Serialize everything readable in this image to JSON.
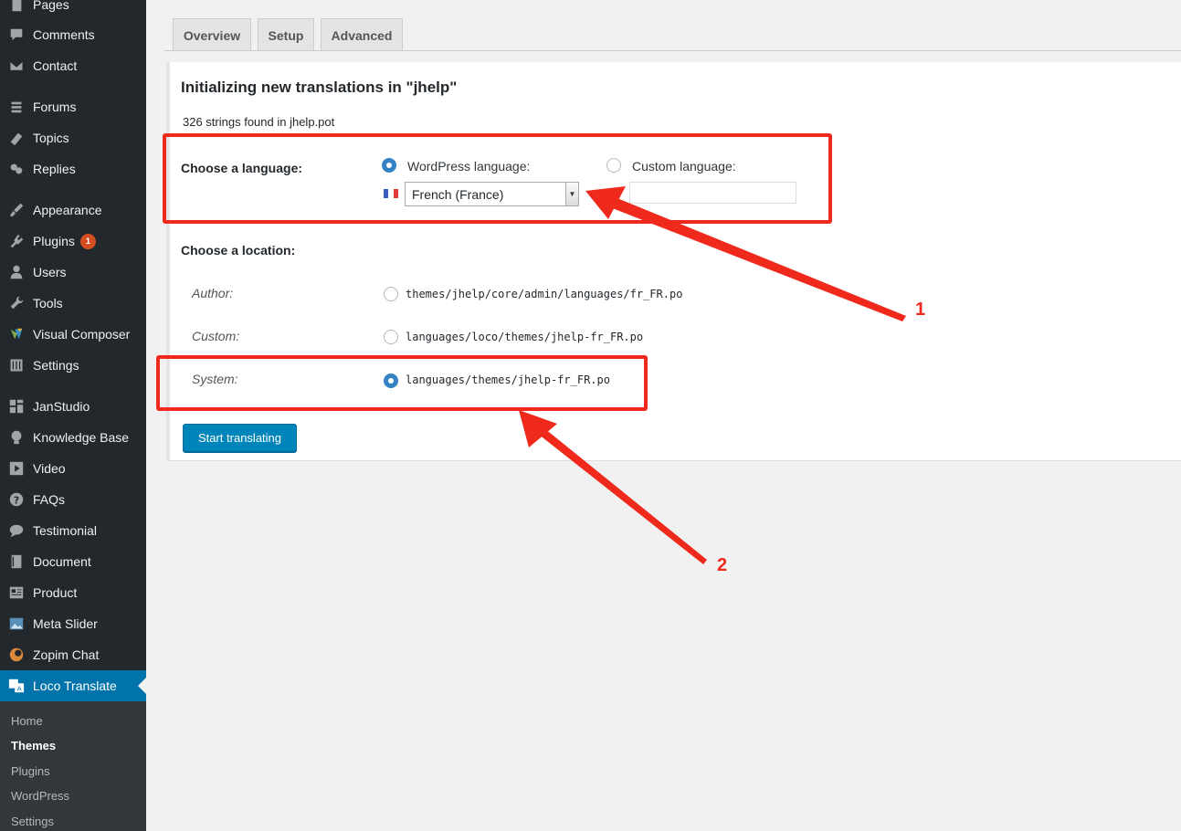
{
  "sidebar": {
    "items": [
      {
        "label": "Pages",
        "icon": "pages-icon"
      },
      {
        "label": "Comments",
        "icon": "comments-icon"
      },
      {
        "label": "Contact",
        "icon": "mail-icon"
      },
      {
        "label": "Forums",
        "icon": "forums-icon"
      },
      {
        "label": "Topics",
        "icon": "topics-icon"
      },
      {
        "label": "Replies",
        "icon": "replies-icon"
      },
      {
        "label": "Appearance",
        "icon": "brush-icon"
      },
      {
        "label": "Plugins",
        "icon": "plugin-icon",
        "badge": "1"
      },
      {
        "label": "Users",
        "icon": "users-icon"
      },
      {
        "label": "Tools",
        "icon": "wrench-icon"
      },
      {
        "label": "Visual Composer",
        "icon": "visual-composer-icon"
      },
      {
        "label": "Settings",
        "icon": "settings-icon"
      },
      {
        "label": "JanStudio",
        "icon": "grid-icon"
      },
      {
        "label": "Knowledge Base",
        "icon": "lightbulb-icon"
      },
      {
        "label": "Video",
        "icon": "video-icon"
      },
      {
        "label": "FAQs",
        "icon": "question-icon"
      },
      {
        "label": "Testimonial",
        "icon": "chat-icon"
      },
      {
        "label": "Document",
        "icon": "book-icon"
      },
      {
        "label": "Product",
        "icon": "product-icon"
      },
      {
        "label": "Meta Slider",
        "icon": "image-icon"
      },
      {
        "label": "Zopim Chat",
        "icon": "zopim-icon"
      },
      {
        "label": "Loco Translate",
        "icon": "translate-icon"
      }
    ],
    "submenu": [
      "Home",
      "Themes",
      "Plugins",
      "WordPress",
      "Settings"
    ]
  },
  "tabs": [
    "Overview",
    "Setup",
    "Advanced"
  ],
  "panel": {
    "title": "Initializing new translations in \"jhelp\"",
    "strings_found": "326 strings found in jhelp.pot",
    "choose_language_label": "Choose a language:",
    "wp_language_option": "WordPress language:",
    "custom_language_option": "Custom language:",
    "selected_language": "French (France)",
    "choose_location_label": "Choose a location:",
    "locations": [
      {
        "label": "Author:",
        "path": "themes/jhelp/core/admin/languages/fr_FR.po",
        "checked": false
      },
      {
        "label": "Custom:",
        "path": "languages/loco/themes/jhelp-fr_FR.po",
        "checked": false
      },
      {
        "label": "System:",
        "path": "languages/themes/jhelp-fr_FR.po",
        "checked": true
      }
    ],
    "start_button": "Start translating"
  },
  "annotations": {
    "one": "1",
    "two": "2"
  },
  "colors": {
    "sidebar_bg": "#23282d",
    "active_bg": "#0073aa",
    "button_bg": "#0085ba",
    "highlight": "#ef2a1c",
    "radio_checked": "#3582c4"
  }
}
